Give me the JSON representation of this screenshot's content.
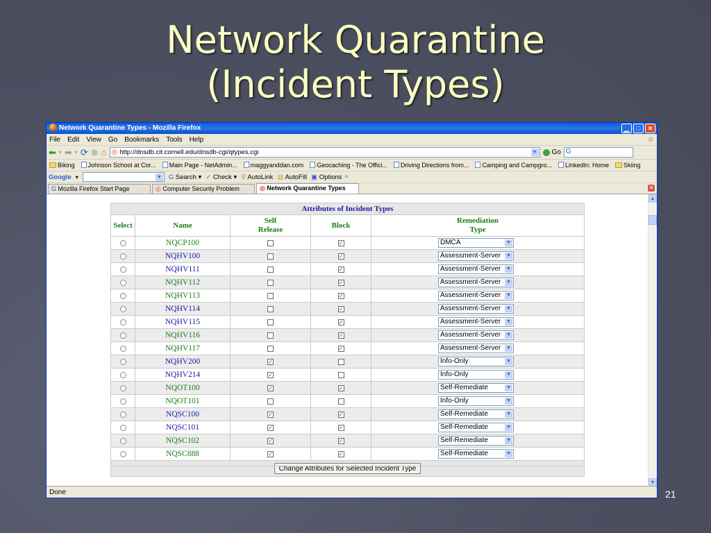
{
  "slide": {
    "title_line1": "Network Quarantine",
    "title_line2": "(Incident Types)",
    "number": "21"
  },
  "browser": {
    "window_title": "Network Quarantine Types - Mozilla Firefox",
    "menu": [
      "File",
      "Edit",
      "View",
      "Go",
      "Bookmarks",
      "Tools",
      "Help"
    ],
    "url": "http://dnsdb.cit.cornell.edu/dnsdb-cgi/qtypes.cgi",
    "go_label": "Go",
    "bookmarks": [
      {
        "label": "Biking",
        "kind": "folder"
      },
      {
        "label": "Johnson School at Cor...",
        "kind": "page"
      },
      {
        "label": "Main Page - NetAdmin...",
        "kind": "page"
      },
      {
        "label": "maggyanddan.com",
        "kind": "page"
      },
      {
        "label": "Geocaching - The Offici...",
        "kind": "page"
      },
      {
        "label": "Driving Directions from...",
        "kind": "page"
      },
      {
        "label": "Camping and Campgro...",
        "kind": "page"
      },
      {
        "label": "LinkedIn: Home",
        "kind": "page"
      },
      {
        "label": "Skiing",
        "kind": "folder"
      }
    ],
    "google_bar": {
      "logo": "Google",
      "search": "Search",
      "check": "Check",
      "autolink": "AutoLink",
      "autofill": "AutoFill",
      "options": "Options"
    },
    "tabs": [
      {
        "label": "Mozilla Firefox Start Page",
        "active": false
      },
      {
        "label": "Computer Security Problem",
        "active": false
      },
      {
        "label": "Network Quarantine Types",
        "active": true
      }
    ],
    "status": "Done"
  },
  "table": {
    "caption": "Attributes of Incident Types",
    "headers": {
      "select": "Select",
      "name": "Name",
      "self_release_1": "Self",
      "self_release_2": "Release",
      "block": "Block",
      "remediation_1": "Remediation",
      "remediation_2": "Type"
    },
    "rows": [
      {
        "name": "NQCP100",
        "color": "green",
        "self_release": false,
        "block": true,
        "remediation": "DMCA"
      },
      {
        "name": "NQHV100",
        "color": "blue",
        "self_release": false,
        "block": true,
        "remediation": "Assessment-Server"
      },
      {
        "name": "NQHV111",
        "color": "blue",
        "self_release": false,
        "block": true,
        "remediation": "Assessment-Server"
      },
      {
        "name": "NQHV112",
        "color": "green",
        "self_release": false,
        "block": true,
        "remediation": "Assessment-Server"
      },
      {
        "name": "NQHV113",
        "color": "green",
        "self_release": false,
        "block": true,
        "remediation": "Assessment-Server"
      },
      {
        "name": "NQHV114",
        "color": "blue",
        "self_release": false,
        "block": true,
        "remediation": "Assessment-Server"
      },
      {
        "name": "NQHV115",
        "color": "blue",
        "self_release": false,
        "block": true,
        "remediation": "Assessment-Server"
      },
      {
        "name": "NQHV116",
        "color": "green",
        "self_release": false,
        "block": true,
        "remediation": "Assessment-Server"
      },
      {
        "name": "NQHV117",
        "color": "green",
        "self_release": false,
        "block": true,
        "remediation": "Assessment-Server"
      },
      {
        "name": "NQHV200",
        "color": "blue",
        "self_release": true,
        "block": false,
        "remediation": "Info-Only"
      },
      {
        "name": "NQHV214",
        "color": "blue",
        "self_release": true,
        "block": false,
        "remediation": "Info-Only"
      },
      {
        "name": "NQOT100",
        "color": "green",
        "self_release": true,
        "block": true,
        "remediation": "Self-Remediate"
      },
      {
        "name": "NQOT101",
        "color": "green",
        "self_release": false,
        "block": false,
        "remediation": "Info-Only"
      },
      {
        "name": "NQSC100",
        "color": "blue",
        "self_release": true,
        "block": true,
        "remediation": "Self-Remediate"
      },
      {
        "name": "NQSC101",
        "color": "blue",
        "self_release": true,
        "block": true,
        "remediation": "Self-Remediate"
      },
      {
        "name": "NQSC102",
        "color": "green",
        "self_release": true,
        "block": true,
        "remediation": "Self-Remediate"
      },
      {
        "name": "NQSC888",
        "color": "green",
        "self_release": true,
        "block": true,
        "remediation": "Self-Remediate"
      }
    ],
    "button": "Change Attributes for Selected Incident Type"
  }
}
